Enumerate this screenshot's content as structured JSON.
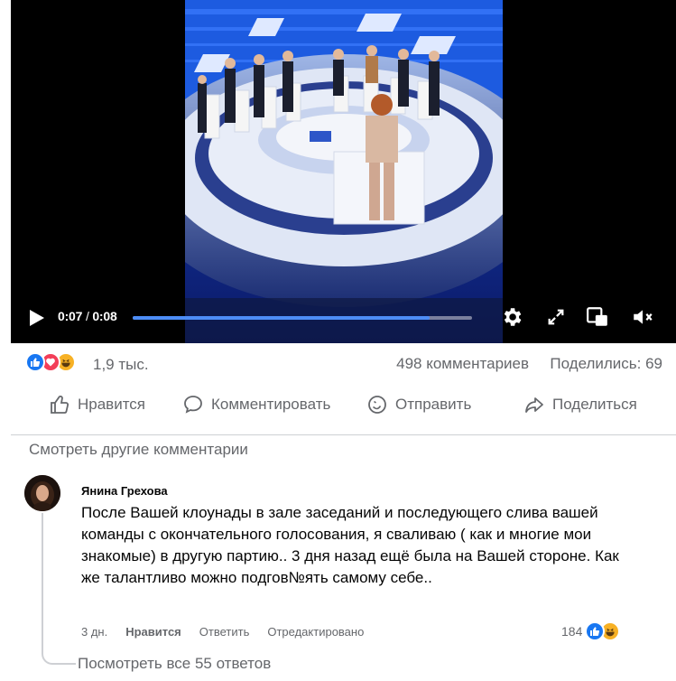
{
  "video": {
    "current_time": "0:07",
    "time_separator": "/",
    "duration": "0:08",
    "progress": 0.875
  },
  "icons": {
    "play": "play-icon",
    "settings": "gear-icon",
    "fullscreen": "fullscreen-icon",
    "pip": "picture-in-picture-icon",
    "mute": "muted-speaker-icon",
    "like": "like-icon",
    "comment": "comment-icon",
    "send": "messenger-icon",
    "share": "share-icon"
  },
  "colors": {
    "accent": "#4d8df6",
    "like_blue": "#1877f2",
    "love_red": "#f33e58",
    "haha_yellow": "#f7b125",
    "muted_text": "#65676b"
  },
  "stats": {
    "reaction_count": "1,9 тыс.",
    "comments": "498 комментариев",
    "shares": "Поделились: 69"
  },
  "actions": {
    "like": "Нравится",
    "comment": "Комментировать",
    "send": "Отправить",
    "share": "Поделиться"
  },
  "more_comments": "Смотреть другие комментарии",
  "comment": {
    "author": "Янина Грехова",
    "text": "После Вашей клоунады в зале заседаний и последующего слива вашей команды с окончательного голосования, я сваливаю ( как и многие мои знакомые) в другую партию.. 3 дня назад ещё была на Вашей стороне. Как же талантливо можно подгов№ять самому себе..",
    "time": "3 дн.",
    "like": "Нравится",
    "reply": "Ответить",
    "edited": "Отредактировано",
    "reaction_count": "184",
    "view_replies": "Посмотреть все 55 ответов"
  }
}
